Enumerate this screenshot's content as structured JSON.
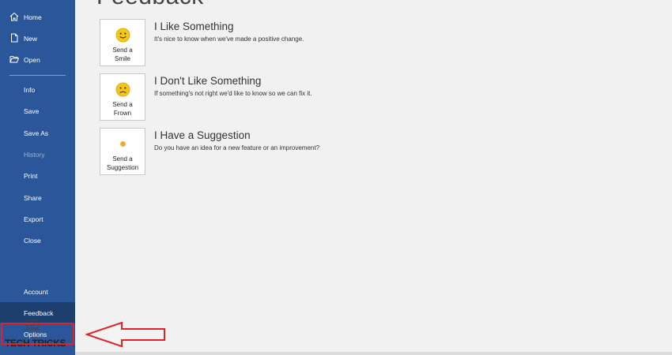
{
  "sidebar": {
    "items": [
      {
        "label": "Home",
        "icon": "home-icon"
      },
      {
        "label": "New",
        "icon": "new-document-icon"
      },
      {
        "label": "Open",
        "icon": "folder-open-icon"
      },
      {
        "label": "Info"
      },
      {
        "label": "Save"
      },
      {
        "label": "Save As"
      },
      {
        "label": "History",
        "state": "disabled"
      },
      {
        "label": "Print"
      },
      {
        "label": "Share"
      },
      {
        "label": "Export"
      },
      {
        "label": "Close"
      },
      {
        "label": "Account"
      },
      {
        "label": "Feedback",
        "state": "selected"
      },
      {
        "label": "Options"
      }
    ]
  },
  "main": {
    "title": "Feedback",
    "options": [
      {
        "button": "Send a Smile",
        "title": "I Like Something",
        "description": "It's nice to know when we've made a positive change.",
        "icon": "smile-face-icon"
      },
      {
        "button": "Send a Frown",
        "title": "I Don't Like Something",
        "description": "If something's not right we'd like to know so we can fix it.",
        "icon": "frown-face-icon"
      },
      {
        "button": "Send a Suggestion",
        "title": "I Have a Suggestion",
        "description": "Do you have an idea for a new feature or an improvement?",
        "icon": "lightbulb-icon"
      }
    ]
  },
  "watermark": {
    "text": "TECH TRICKS"
  },
  "colors": {
    "sidebar": "#2b579a",
    "sidebar_selected": "#1d3f70",
    "background": "#f1f1f1",
    "highlight": "#e0222a",
    "emoji": "#f5c518"
  }
}
